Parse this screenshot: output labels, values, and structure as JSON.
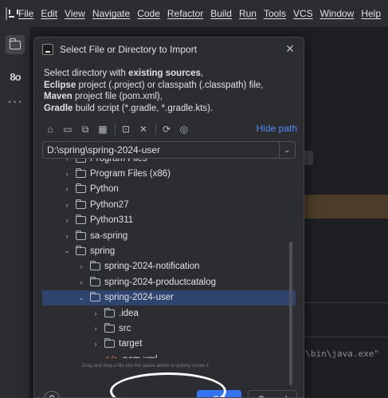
{
  "menubar": {
    "items": [
      "File",
      "Edit",
      "View",
      "Navigate",
      "Code",
      "Refactor",
      "Build",
      "Run",
      "Tools",
      "VCS",
      "Window",
      "Help"
    ]
  },
  "toolstrip": {
    "icons": [
      "folder-icon",
      "structure-icon",
      "more-icon"
    ],
    "structure_glyph": "8o",
    "more_glyph": "···"
  },
  "editor": {
    "run_command": "ot\\bin\\java.exe\""
  },
  "dialog": {
    "title": "Select File or Directory to Import",
    "close_glyph": "✕",
    "description": {
      "line1_pre": "Select directory with ",
      "line1_bold": "existing sources",
      "line1_post": ",",
      "line2_bold": "Eclipse",
      "line2_post": " project (.project) or classpath (.classpath) file,",
      "line3_bold": "Maven",
      "line3_post": " project file (pom.xml),",
      "line4_bold": "Gradle",
      "line4_post": " build script (*.gradle, *.gradle.kts)."
    },
    "toolbar": {
      "hide_path_label": "Hide path",
      "home_glyph": "⌂",
      "desktop_glyph": "▭",
      "project_glyph": "⧉",
      "module_glyph": "▦",
      "new_folder_glyph": "⊡",
      "delete_glyph": "✕",
      "refresh_glyph": "⟳",
      "show_hidden_glyph": "◎"
    },
    "path": {
      "value": "D:\\spring\\spring-2024-user",
      "drop_glyph": "⌄"
    },
    "tree": {
      "rows": [
        {
          "label": "Program Files",
          "depth": 1,
          "expanded": false,
          "selected": false
        },
        {
          "label": "Program Files (x86)",
          "depth": 1,
          "expanded": false,
          "selected": false
        },
        {
          "label": "Python",
          "depth": 1,
          "expanded": false,
          "selected": false
        },
        {
          "label": "Python27",
          "depth": 1,
          "expanded": false,
          "selected": false
        },
        {
          "label": "Python311",
          "depth": 1,
          "expanded": false,
          "selected": false
        },
        {
          "label": "sa-spring",
          "depth": 1,
          "expanded": false,
          "selected": false
        },
        {
          "label": "spring",
          "depth": 1,
          "expanded": true,
          "selected": false
        },
        {
          "label": "spring-2024-notification",
          "depth": 2,
          "expanded": false,
          "selected": false
        },
        {
          "label": "spring-2024-productcatalog",
          "depth": 2,
          "expanded": false,
          "selected": false
        },
        {
          "label": "spring-2024-user",
          "depth": 2,
          "expanded": true,
          "selected": true
        },
        {
          "label": ".idea",
          "depth": 3,
          "expanded": false,
          "selected": false
        },
        {
          "label": "src",
          "depth": 3,
          "expanded": false,
          "selected": false
        },
        {
          "label": "target",
          "depth": 3,
          "expanded": false,
          "selected": false
        },
        {
          "label": "pom.xml",
          "depth": 3,
          "file": true,
          "selected": false
        }
      ],
      "collapsed_glyph": "›",
      "expanded_glyph": "⌄",
      "xml_glyph": "</>"
    },
    "drag_hint": "Drag and drop a file into the space above to quickly locate it",
    "buttons": {
      "help": "?",
      "ok": "OK",
      "cancel": "Cancel"
    }
  },
  "colors": {
    "accent": "#3574f0",
    "link": "#548af7",
    "selection": "#2e436e",
    "annotation": "#ffffff"
  }
}
